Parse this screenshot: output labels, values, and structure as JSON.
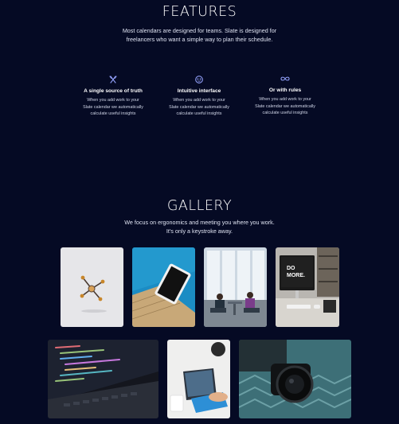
{
  "features": {
    "title": "FEATURES",
    "subtitle_lines": [
      "Most calendars are designed for teams. Slate is designed for",
      "freelancers who want a simple way to plan their schedule."
    ],
    "items": [
      {
        "icon": "utensils-icon",
        "title": "A single source of truth",
        "desc_lines": [
          "When you add work to your",
          "Slate calendar we automatically",
          "calculate useful insights"
        ]
      },
      {
        "icon": "face-icon",
        "title": "Intuitive interface",
        "desc_lines": [
          "When you add work to your",
          "Slate calendar we automatically",
          "calculate useful insights"
        ]
      },
      {
        "icon": "infinity-icon",
        "title": "Or with rules",
        "desc_lines": [
          "When you add work to your",
          "Slate calendar we automatically",
          "calculate useful insights"
        ]
      }
    ]
  },
  "gallery": {
    "title": "GALLERY",
    "subtitle_lines": [
      "We focus on ergonomics and meeting you where you work.",
      "It's only a keystroke away."
    ],
    "photo_text": {
      "monitor_line1": "DO",
      "monitor_line2": "MORE."
    }
  },
  "colors": {
    "background": "#050a24",
    "icon_accent": "#8f9df5"
  }
}
